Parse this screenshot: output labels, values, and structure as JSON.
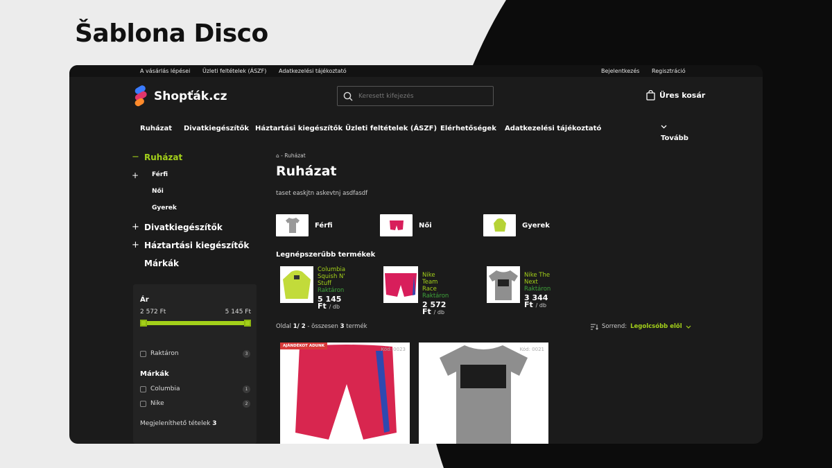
{
  "promo_title": "Šablona Disco",
  "topbar": {
    "left": [
      "A vásárlás lépései",
      "Üzleti feltételek (ÁSZF)",
      "Adatkezelési tájékoztató"
    ],
    "login": "Bejelentkezés",
    "register": "Regisztráció"
  },
  "header": {
    "logo": "Shopťák.cz",
    "search_placeholder": "Keresett kifejezés",
    "cart": "Üres kosár"
  },
  "nav": {
    "items": [
      "Ruházat",
      "Divatkiegészítők",
      "Háztartási kiegészítők",
      "Üzleti feltételek (ÁSZF)",
      "Elérhetőségek",
      "Adatkezelési tájékoztató"
    ],
    "more": "Tovább"
  },
  "sidebar": {
    "active": "Ruházat",
    "subs": [
      "Férfi",
      "Női",
      "Gyerek"
    ],
    "others": [
      "Divatkiegészítők",
      "Háztartási kiegészítők"
    ],
    "brands_link": "Márkák",
    "filter": {
      "price_title": "Ár",
      "price_min": "2 572 Ft",
      "price_max": "5 145 Ft",
      "in_stock": "Raktáron",
      "in_stock_count": "3",
      "brands_title": "Márkák",
      "brands": [
        {
          "name": "Columbia",
          "count": "1"
        },
        {
          "name": "Nike",
          "count": "2"
        }
      ],
      "shown_label": "Megjeleníthető tételek",
      "shown_count": "3"
    }
  },
  "main": {
    "breadcrumb": "- Ruházat",
    "title": "Ruházat",
    "description": "taset easkjtn askevtnj asdfasdf",
    "subcategories": [
      "Férfi",
      "Női",
      "Gyerek"
    ],
    "popular_title": "Legnépszerűbb termékek",
    "popular": [
      {
        "name1": "Columbia",
        "name2": "Squish N' Stuff",
        "stock": "Raktáron",
        "price": "5 145 Ft",
        "unit": "/ db"
      },
      {
        "name1": "Nike Team Race",
        "name2": "",
        "stock": "Raktáron",
        "price": "2 572 Ft",
        "unit": "/ db"
      },
      {
        "name1": "Nike The Next",
        "name2": "",
        "stock": "Raktáron",
        "price": "3 344 Ft",
        "unit": "/ db"
      }
    ],
    "paging": {
      "prefix": "Oldal",
      "page": "1/ 2",
      "mid": "- összesen",
      "count": "3",
      "suffix": "termék"
    },
    "sort": {
      "label": "Sorrend:",
      "value": "Legolcsóbb elől"
    },
    "products": [
      {
        "badge": "AJÁNDÉKOT ADUNK",
        "code": "Kód: 0023"
      },
      {
        "badge": "",
        "code": "Kód: 0021"
      }
    ]
  },
  "colors": {
    "accent": "#a3d01a",
    "stock": "#3fa43a",
    "badge": "#d83a3a"
  }
}
